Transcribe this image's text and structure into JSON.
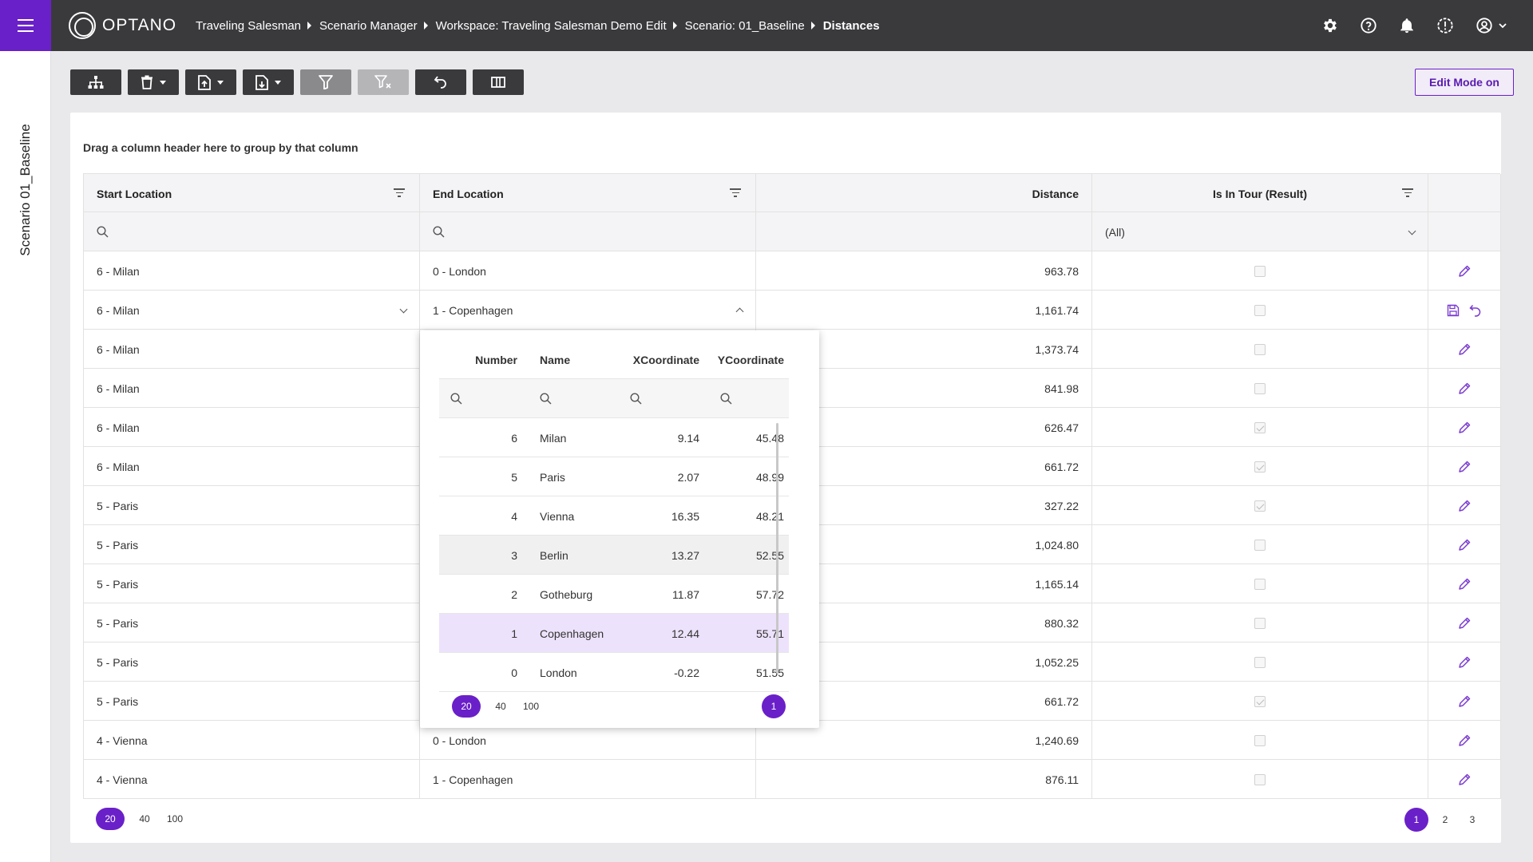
{
  "topbar": {
    "logo_text": "OPTANO",
    "breadcrumb": [
      "Traveling Salesman",
      "Scenario Manager",
      "Workspace: Traveling Salesman Demo Edit",
      "Scenario: 01_Baseline",
      "Distances"
    ],
    "icons": [
      "gear-icon",
      "help-icon",
      "bell-icon",
      "alert-icon",
      "account-icon",
      "chevron-down-icon"
    ]
  },
  "siderail": {
    "title": "Scenario 01_Baseline"
  },
  "toolbar": {
    "edit_mode_label": "Edit Mode on"
  },
  "grid": {
    "group_hint": "Drag a column header here to group by that column",
    "columns": [
      "Start Location",
      "End Location",
      "Distance",
      "Is In Tour (Result)"
    ],
    "tour_filter_value": "(All)",
    "rows": [
      {
        "start": "6 - Milan",
        "end": "0 - London",
        "distance": "963.78",
        "in_tour": false
      },
      {
        "start": "6 - Milan",
        "end": "1 - Copenhagen",
        "distance": "1,161.74",
        "in_tour": false
      },
      {
        "start": "6 - Milan",
        "end": "",
        "distance": "1,373.74",
        "in_tour": false
      },
      {
        "start": "6 - Milan",
        "end": "",
        "distance": "841.98",
        "in_tour": false
      },
      {
        "start": "6 - Milan",
        "end": "",
        "distance": "626.47",
        "in_tour": true
      },
      {
        "start": "6 - Milan",
        "end": "",
        "distance": "661.72",
        "in_tour": true
      },
      {
        "start": "5 - Paris",
        "end": "",
        "distance": "327.22",
        "in_tour": true
      },
      {
        "start": "5 - Paris",
        "end": "",
        "distance": "1,024.80",
        "in_tour": false
      },
      {
        "start": "5 - Paris",
        "end": "",
        "distance": "1,165.14",
        "in_tour": false
      },
      {
        "start": "5 - Paris",
        "end": "",
        "distance": "880.32",
        "in_tour": false
      },
      {
        "start": "5 - Paris",
        "end": "",
        "distance": "1,052.25",
        "in_tour": false
      },
      {
        "start": "5 - Paris",
        "end": "",
        "distance": "661.72",
        "in_tour": true
      },
      {
        "start": "4 - Vienna",
        "end": "0 - London",
        "distance": "1,240.69",
        "in_tour": false
      },
      {
        "start": "4 - Vienna",
        "end": "1 - Copenhagen",
        "distance": "876.11",
        "in_tour": false
      }
    ],
    "page_sizes": [
      "20",
      "40",
      "100"
    ],
    "pages": [
      "1",
      "2",
      "3"
    ]
  },
  "popup": {
    "columns": [
      "Number",
      "Name",
      "XCoordinate",
      "YCoordinate"
    ],
    "rows": [
      {
        "number": "6",
        "name": "Milan",
        "x": "9.14",
        "y": "45.48"
      },
      {
        "number": "5",
        "name": "Paris",
        "x": "2.07",
        "y": "48.99"
      },
      {
        "number": "4",
        "name": "Vienna",
        "x": "16.35",
        "y": "48.21"
      },
      {
        "number": "3",
        "name": "Berlin",
        "x": "13.27",
        "y": "52.55"
      },
      {
        "number": "2",
        "name": "Gotheburg",
        "x": "11.87",
        "y": "57.72"
      },
      {
        "number": "1",
        "name": "Copenhagen",
        "x": "12.44",
        "y": "55.71"
      },
      {
        "number": "0",
        "name": "London",
        "x": "-0.22",
        "y": "51.55"
      }
    ],
    "page_sizes": [
      "20",
      "40",
      "100"
    ],
    "pages": [
      "1"
    ]
  },
  "colors": {
    "accent": "#6a20c8",
    "topbar": "#3a3a3d",
    "selected_row": "#ede2fb"
  }
}
